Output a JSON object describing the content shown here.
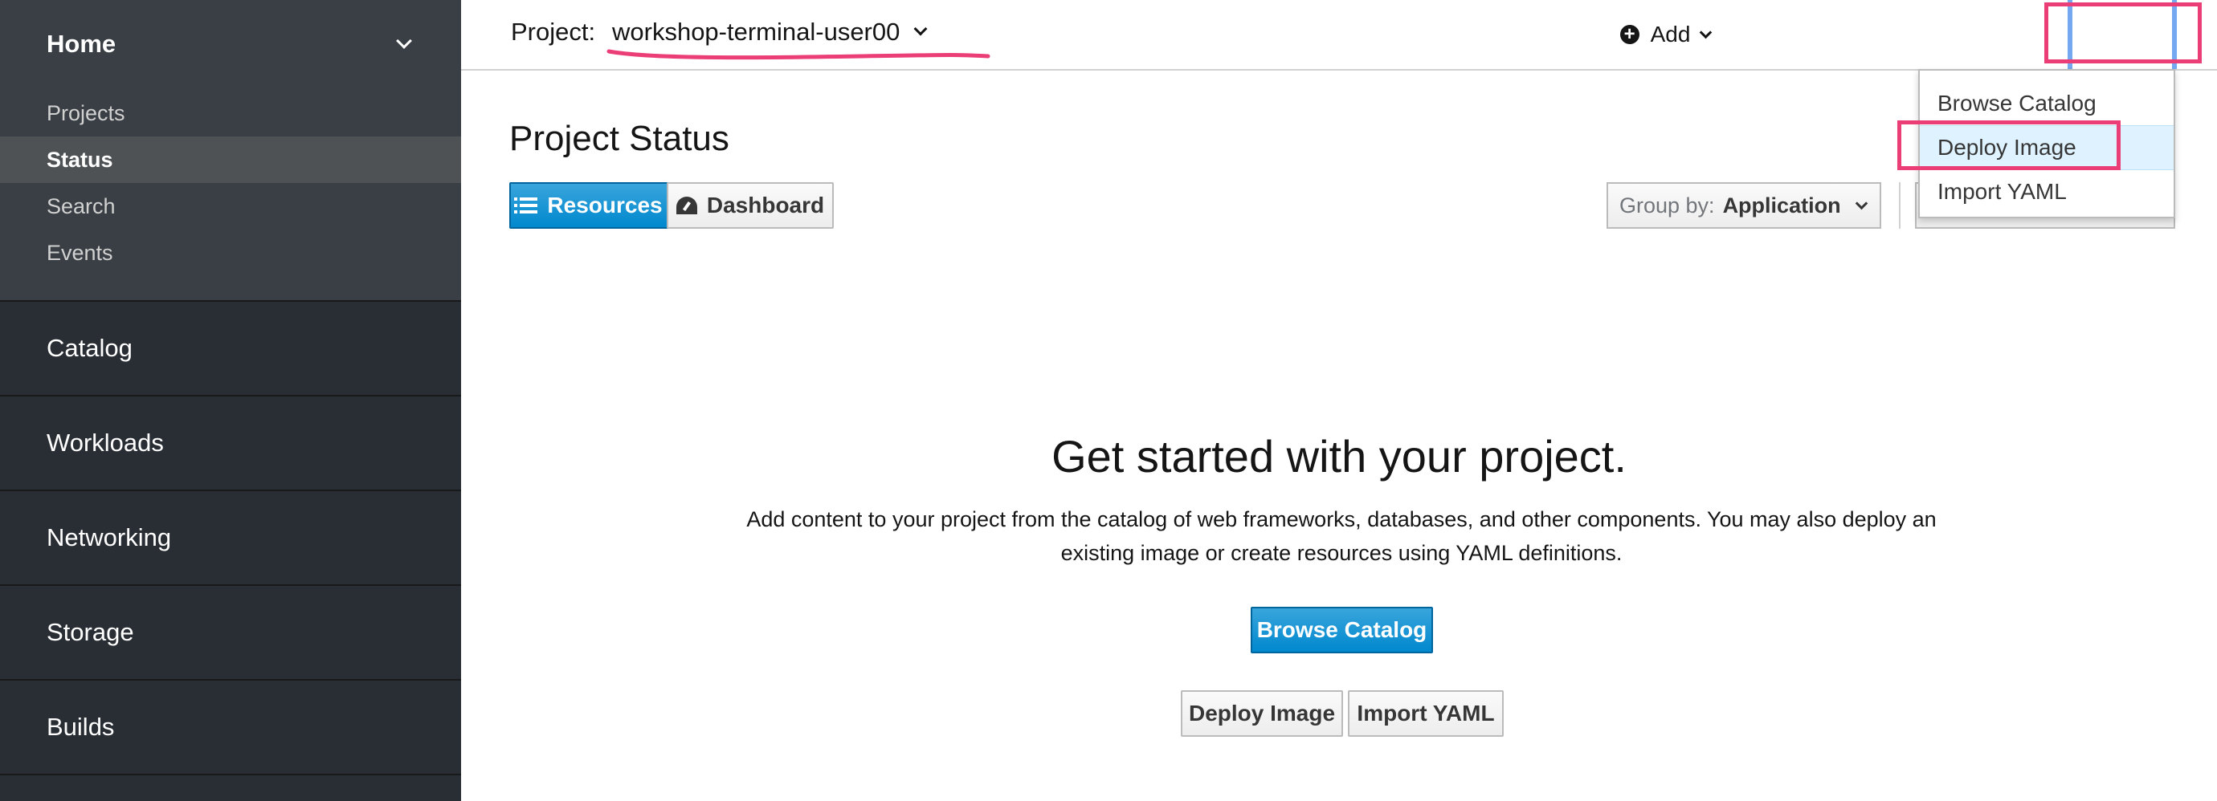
{
  "sidebar": {
    "home": {
      "label": "Home",
      "icon": "chevron-down-icon"
    },
    "home_items": [
      {
        "label": "Projects"
      },
      {
        "label": "Status"
      },
      {
        "label": "Search"
      },
      {
        "label": "Events"
      }
    ],
    "active_item": "Status",
    "nav_items": [
      {
        "label": "Catalog"
      },
      {
        "label": "Workloads"
      },
      {
        "label": "Networking"
      },
      {
        "label": "Storage"
      },
      {
        "label": "Builds"
      }
    ]
  },
  "topbar": {
    "project_label": "Project:",
    "project_value": "workshop-terminal-user00",
    "add_label": "Add",
    "add_icon": "plus-circle-icon"
  },
  "add_menu": {
    "items": [
      {
        "label": "Browse Catalog"
      },
      {
        "label": "Deploy Image"
      },
      {
        "label": "Import YAML"
      }
    ],
    "hovered": "Deploy Image"
  },
  "main": {
    "title": "Project Status",
    "view_toggle": {
      "resources": "Resources",
      "dashboard": "Dashboard",
      "active": "Resources"
    },
    "group_by": {
      "label": "Group by:",
      "value": "Application"
    },
    "empty_state": {
      "title": "Get started with your project.",
      "description": "Add content to your project from the catalog of web frameworks, databases, and other components. You may also deploy an existing image or create resources using YAML definitions.",
      "browse_button": "Browse Catalog",
      "deploy_button": "Deploy Image",
      "import_button": "Import YAML"
    }
  },
  "colors": {
    "sidebar_bg": "#292e34",
    "sidebar_section_bg": "#393f44",
    "active_item_bg": "#4f5255",
    "primary": "#0088ce",
    "annotation": "#ec3e76",
    "dropdown_hover": "#def3ff"
  }
}
